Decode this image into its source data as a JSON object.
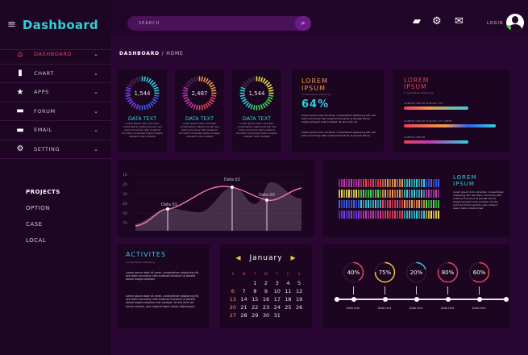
{
  "app": {
    "title": "Dashboard"
  },
  "search": {
    "placeholder": "SEARCH"
  },
  "topbar": {
    "login_label": "LOGIN"
  },
  "breadcrumb": {
    "section": "DASHBOARD",
    "separator": " / ",
    "page": "HOME"
  },
  "sidebar": {
    "items": [
      {
        "label": "DASHBOARD",
        "icon": "home-icon",
        "glyph": "⌂",
        "active": true
      },
      {
        "label": "CHART",
        "icon": "bar-chart-icon",
        "glyph": "▮",
        "active": false
      },
      {
        "label": "APPS",
        "icon": "star-icon",
        "glyph": "★",
        "active": false
      },
      {
        "label": "FORUM",
        "icon": "chat-icon",
        "glyph": "▬",
        "active": false
      },
      {
        "label": "EMAIL",
        "icon": "mail-icon",
        "glyph": "▬",
        "active": false
      },
      {
        "label": "SETTING",
        "icon": "gears-icon",
        "glyph": "⚙",
        "active": false
      }
    ],
    "projects": {
      "heading": "PROJECTS",
      "links": [
        "OPTION",
        "CASE",
        "LOCAL"
      ]
    }
  },
  "stats": [
    {
      "value": "1,544",
      "title": "DATA TEXT",
      "text": "Lorem ipsum dolor sit amet, consectetuer adipiscing elit, sed diam nonummy nibh euismod tincidunt ut laoreet dolore magna aliquam erat volutpat",
      "colors": [
        "#2fd0d8",
        "#3a5ff0",
        "#7b3ff0"
      ]
    },
    {
      "value": "2,487",
      "title": "DATA TEXT",
      "text": "Lorem ipsum dolor sit amet, consectetuer adipiscing elit, sed diam nonummy nibh euismod tincidunt ut laoreet dolore magna aliquam erat volutpat",
      "colors": [
        "#f09a4a",
        "#e8435a",
        "#c03ab0"
      ]
    },
    {
      "value": "1,544",
      "title": "DATA TEXT",
      "text": "Lorem ipsum dolor sit amet, consectetuer adipiscing elit, sed diam nonummy nibh euismod tincidunt ut laoreet dolore magna aliquam erat volutpat",
      "colors": [
        "#f0e040",
        "#3fe04a",
        "#2fd0d8"
      ]
    }
  ],
  "lorem_percent": {
    "title": "LOREM IPSUM",
    "subtitle": "Consectetuer adipiscing",
    "percent": "64%",
    "para1": "Lorem ipsum dolor sit amet, consectetuer adipiscing elit, sed diam nonummy nibh euismod tincidunt ut laoreet dolore magna aliquam erat volutpat. Ut wisi enim ad",
    "para2": "Lorem ipsum dolor sit amet, consectetuer adipiscing elit, sed diam nonummy nibh euismod tincidunt ut laoreet dolore"
  },
  "lorem_bars": {
    "title": "LOREM IPSUM",
    "subtitle": "Consectetuer adipiscing",
    "bars": [
      {
        "label": "LOREM IPSUM DOLOR SIT",
        "fill": 0.62
      },
      {
        "label": "LOREM IPSUM DOLOR SIT AMET",
        "fill": 0.88
      },
      {
        "label": "LOREM IPSUM",
        "fill": 0.62
      }
    ]
  },
  "line_chart": {
    "yticks": [
      "10",
      "20",
      "30",
      "40",
      "50",
      "70"
    ],
    "annotations": [
      "Data 01",
      "Data 02",
      "Data 03"
    ]
  },
  "heatmap": {
    "title": "LOREM IPSUM",
    "text": "Lorem ipsum dolor sit amet, consectetuer adipiscing elit, sed diam nonummy nibh euismod tincidunt ut laoreet dolore magna aliquam erat volutpat. Ut wisi enim ad minim veniam, quis nostrud exerci tation ullamcorper"
  },
  "activities": {
    "title": "ACTIVITES",
    "subtitle": "Consectetuer adipiscing",
    "para1": "Lorem ipsum dolor sit amet, consectetuer adipiscing elit, sed diam nonummy nibh euismod tincidunt ut laoreet dolore magna aliquam",
    "para2": "Lorem ipsum dolor sit amet, consectetuer adipiscing elit, sed diam nonummy nibh euismod tincidunt ut laoreet dolore magna aliquam erat volutpat. Ut wisi enim ad minim veniam, quis nostrud exerci tation ullamcorper"
  },
  "calendar": {
    "month": "January",
    "prev_glyph": "◀",
    "next_glyph": "▶",
    "dow": [
      "S",
      "M",
      "T",
      "W",
      "T",
      "F",
      "S"
    ],
    "days": [
      "",
      "",
      "1",
      "2",
      "3",
      "4",
      "5",
      "6",
      "7",
      "8",
      "9",
      "10",
      "11",
      "12",
      "13",
      "14",
      "15",
      "16",
      "17",
      "18",
      "19",
      "20",
      "21",
      "22",
      "23",
      "24",
      "25",
      "26",
      "27",
      "28",
      "29",
      "30",
      "31"
    ]
  },
  "timeline": {
    "items": [
      {
        "value": "40%",
        "fill": 0.4,
        "color": "#e8435a",
        "label": "Data text"
      },
      {
        "value": "75%",
        "fill": 0.75,
        "color": "#f0c040",
        "label": "Data text"
      },
      {
        "value": "20%",
        "fill": 0.2,
        "color": "#2fd0d8",
        "label": "Data text"
      },
      {
        "value": "80%",
        "fill": 0.8,
        "color": "#e8435a",
        "label": "Data text"
      },
      {
        "value": "60%",
        "fill": 0.6,
        "color": "#e8435a",
        "label": "Data text"
      }
    ]
  },
  "colors": {
    "accent": "#2fd0d8",
    "danger": "#e8435a",
    "orange": "#f09a4a",
    "background": "#2a0733"
  }
}
